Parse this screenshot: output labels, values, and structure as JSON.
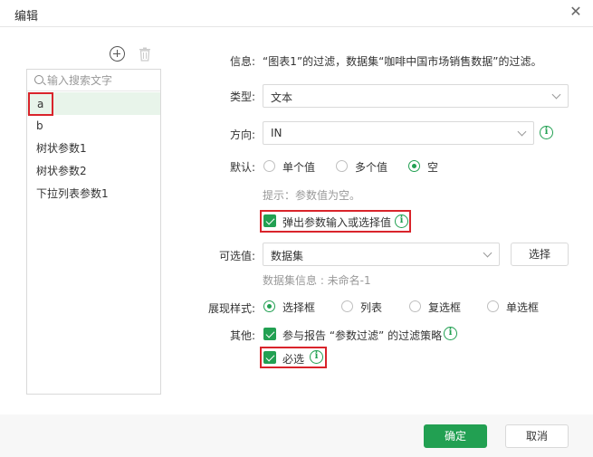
{
  "dialog": {
    "title": "编辑",
    "close_icon": "close-icon"
  },
  "left": {
    "search_placeholder": "输入搜索文字",
    "items": [
      {
        "label": "a",
        "selected": true
      },
      {
        "label": "b"
      },
      {
        "label": "树状参数1"
      },
      {
        "label": "树状参数2"
      },
      {
        "label": "下拉列表参数1"
      }
    ]
  },
  "form": {
    "info_label": "信息:",
    "info_text": "“图表1”的过滤，数据集“咖啡中国市场销售数据”的过滤。",
    "type_label": "类型:",
    "type_value": "文本",
    "direction_label": "方向:",
    "direction_value": "IN",
    "default_label": "默认:",
    "default_options": [
      "单个值",
      "多个值",
      "空"
    ],
    "default_selected": "空",
    "hint": "提示：参数值为空。",
    "popup_checkbox_label": "弹出参数输入或选择值",
    "optional_label": "可选值:",
    "optional_value": "数据集",
    "select_button": "选择",
    "dataset_info": "数据集信息 : 未命名-1",
    "style_label": "展现样式:",
    "style_options": [
      "选择框",
      "列表",
      "复选框",
      "单选框"
    ],
    "style_selected": "选择框",
    "other_label": "其他:",
    "participate_label": "参与报告 “参数过滤” 的过滤策略",
    "required_label": "必选"
  },
  "footer": {
    "ok": "确定",
    "cancel": "取消"
  },
  "colors": {
    "accent": "#22a052",
    "highlight": "#d9242b"
  }
}
